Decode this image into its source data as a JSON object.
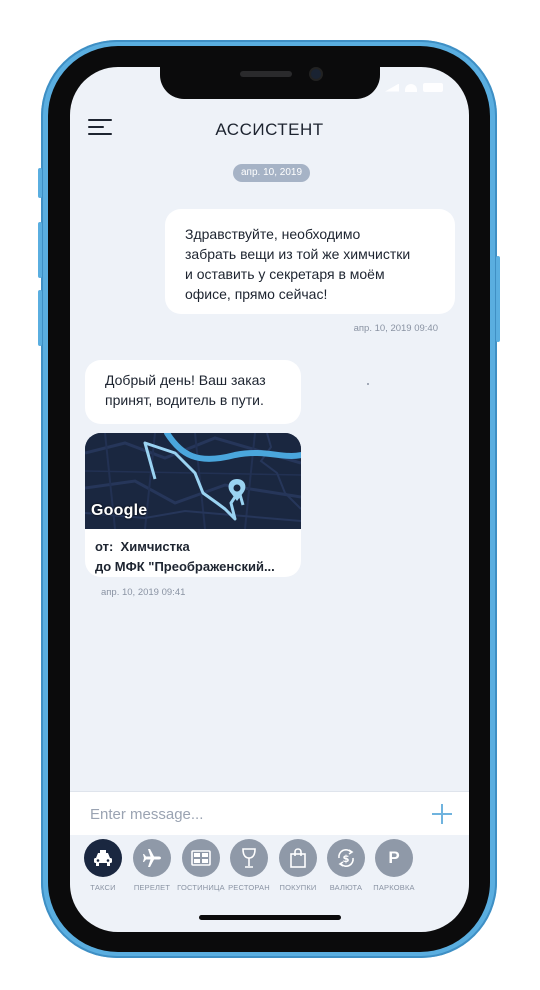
{
  "header": {
    "title": "АССИСТЕНТ"
  },
  "chat": {
    "date_divider": "апр. 10, 2019",
    "messages": [
      {
        "from": "user",
        "text": "Здравствуйте, необходимо\nзабрать вещи из той же химчистки\nи оставить у секретаря в моём\nофисе, прямо сейчас!",
        "time": "апр. 10, 2019 09:40"
      },
      {
        "from": "assistant",
        "text": "Добрый день! Ваш заказ\nпринят, водитель в пути.",
        "time": "апр. 10, 2019 09:41"
      }
    ],
    "map_card": {
      "brand": "Google",
      "from_line": "от:  Химчистка",
      "to_line": "до МФК \"Преображенский..."
    }
  },
  "composer": {
    "placeholder": "Enter message..."
  },
  "services": [
    {
      "label": "ТАКСИ",
      "icon": "taxi-icon",
      "active": true
    },
    {
      "label": "ПЕРЕЛЕТ",
      "icon": "airplane-icon",
      "active": false
    },
    {
      "label": "ГОСТИНИЦА",
      "icon": "hotel-icon",
      "active": false
    },
    {
      "label": "РЕСТОРАН",
      "icon": "wineglass-icon",
      "active": false
    },
    {
      "label": "ПОКУПКИ",
      "icon": "shopping-bag-icon",
      "active": false
    },
    {
      "label": "ВАЛЮТА",
      "icon": "currency-exchange-icon",
      "active": false
    },
    {
      "label": "ПАРКОВКА",
      "icon": "parking-icon",
      "active": false
    }
  ],
  "colors": {
    "frame": "#5aaee0",
    "screen_bg": "#eef2f8",
    "accent": "#6fb3de",
    "dark": "#1a2740"
  }
}
